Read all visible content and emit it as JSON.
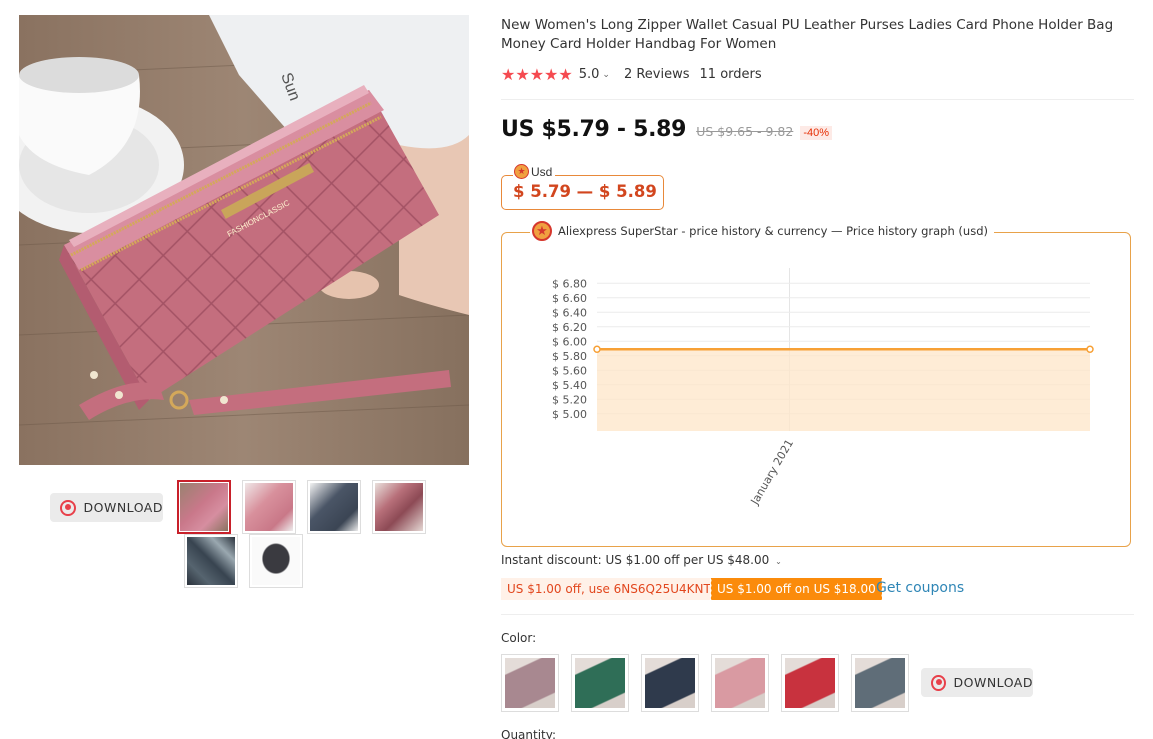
{
  "product": {
    "title": "New Women's Long Zipper Wallet Casual PU Leather Purses Ladies Card Phone Holder Bag Money Card Holder Handbag For Women",
    "stars": "★★★★★",
    "rating": "5.0",
    "rating_chevron": "⌄",
    "reviews": "2 Reviews",
    "orders": "11 orders",
    "price": "US $5.79 - 5.89",
    "original_price": "US $9.65 - 9.82",
    "discount": "-40%"
  },
  "gallery": {
    "download_label": "DOWNLOAD",
    "brand_text": "FASHIONCLASSIC",
    "book_text": "Sun",
    "thumbnails": [
      {
        "color": "#c9788a",
        "selected": true
      },
      {
        "color": "#d8909c",
        "selected": false
      },
      {
        "color": "#4a5566",
        "selected": false
      },
      {
        "color": "#b8707a",
        "selected": false
      },
      {
        "color": "#384450",
        "selected": false
      },
      {
        "color": "#3a3a40",
        "selected": false
      }
    ]
  },
  "currency_box": {
    "label": "Usd",
    "price": "$ 5.79 — $ 5.89"
  },
  "price_history": {
    "label": "Aliexpress SuperStar - price history & currency — Price history graph (usd)",
    "badge_icon": "star-badge-icon"
  },
  "chart_data": {
    "type": "line",
    "title": "",
    "xlabel": "",
    "ylabel": "",
    "y_ticks": [
      "$ 6.80",
      "$ 6.60",
      "$ 6.40",
      "$ 6.20",
      "$ 6.00",
      "$ 5.80",
      "$ 5.60",
      "$ 5.40",
      "$ 5.20",
      "$ 5.00"
    ],
    "x_ticks": [
      "January 2021"
    ],
    "ylim": [
      4.9,
      6.9
    ],
    "grid": true,
    "series": [
      {
        "values": [
          5.89,
          5.89
        ],
        "color": "#f7a035",
        "fill": "#fde5c8"
      }
    ]
  },
  "promotions": {
    "instant_discount": "Instant discount: US $1.00 off per US $48.00",
    "instant_chevron": "⌄",
    "coupon_code": "US $1.00 off, use 6NS6Q25U4KNT",
    "coupon_store": "US $1.00 off on US $18.00",
    "get_coupons": "Get coupons"
  },
  "options": {
    "color_label": "Color:",
    "colors": [
      {
        "color": "#a88890"
      },
      {
        "color": "#2f6e57"
      },
      {
        "color": "#2f3a4c"
      },
      {
        "color": "#d99aa2"
      },
      {
        "color": "#c8323e"
      },
      {
        "color": "#5f6d78"
      }
    ],
    "download_label": "DOWNLOAD",
    "quantity_label": "Quantity:"
  }
}
